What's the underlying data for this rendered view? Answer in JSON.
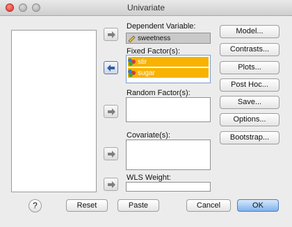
{
  "window": {
    "title": "Univariate"
  },
  "dependent": {
    "label": "Dependent Variable:",
    "value": "sweetness"
  },
  "fixed": {
    "label": "Fixed Factor(s):",
    "items": [
      "stir",
      "sugar"
    ]
  },
  "random": {
    "label": "Random Factor(s):"
  },
  "covariate": {
    "label": "Covariate(s):"
  },
  "wls": {
    "label": "WLS Weight:"
  },
  "side_buttons": [
    "Model...",
    "Contrasts...",
    "Plots...",
    "Post Hoc...",
    "Save...",
    "Options...",
    "Bootstrap..."
  ],
  "bottom": {
    "help": "?",
    "reset": "Reset",
    "paste": "Paste",
    "cancel": "Cancel",
    "ok": "OK"
  },
  "colors": {
    "selection": "#f8b200",
    "ok_button": "#7fb2ec"
  }
}
